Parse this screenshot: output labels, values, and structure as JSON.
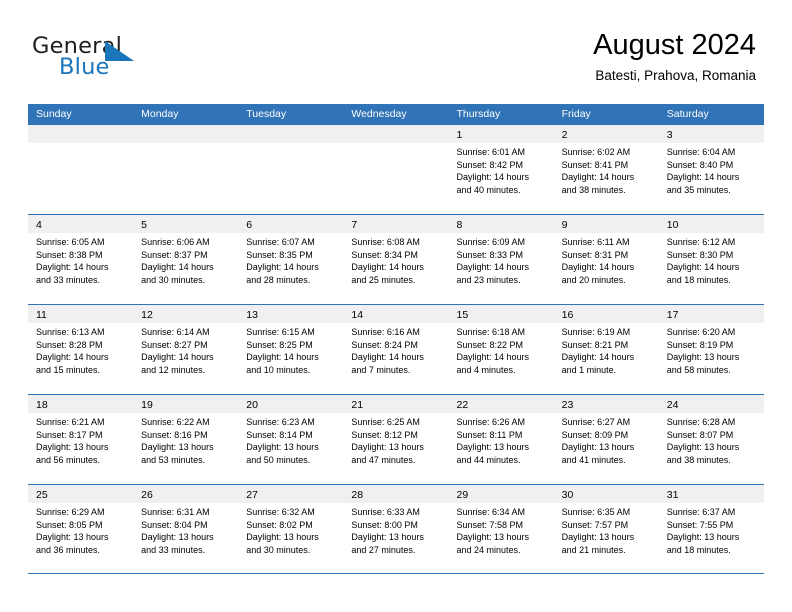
{
  "brand": {
    "name_top": "General",
    "name_bottom": "Blue",
    "accent_color": "#1b75bb"
  },
  "header": {
    "title": "August 2024",
    "subtitle": "Batesti, Prahova, Romania"
  },
  "theme": {
    "header_band_color": "#3073b6",
    "day_band_color": "#f0f0f0",
    "text_color": "#000000"
  },
  "calendar": {
    "weekday_headers": [
      "Sunday",
      "Monday",
      "Tuesday",
      "Wednesday",
      "Thursday",
      "Friday",
      "Saturday"
    ],
    "weeks": [
      [
        {
          "day": "",
          "sunrise": "",
          "sunset": "",
          "daylight": "",
          "daylight_cont": ""
        },
        {
          "day": "",
          "sunrise": "",
          "sunset": "",
          "daylight": "",
          "daylight_cont": ""
        },
        {
          "day": "",
          "sunrise": "",
          "sunset": "",
          "daylight": "",
          "daylight_cont": ""
        },
        {
          "day": "",
          "sunrise": "",
          "sunset": "",
          "daylight": "",
          "daylight_cont": ""
        },
        {
          "day": "1",
          "sunrise": "Sunrise: 6:01 AM",
          "sunset": "Sunset: 8:42 PM",
          "daylight": "Daylight: 14 hours",
          "daylight_cont": "and 40 minutes."
        },
        {
          "day": "2",
          "sunrise": "Sunrise: 6:02 AM",
          "sunset": "Sunset: 8:41 PM",
          "daylight": "Daylight: 14 hours",
          "daylight_cont": "and 38 minutes."
        },
        {
          "day": "3",
          "sunrise": "Sunrise: 6:04 AM",
          "sunset": "Sunset: 8:40 PM",
          "daylight": "Daylight: 14 hours",
          "daylight_cont": "and 35 minutes."
        }
      ],
      [
        {
          "day": "4",
          "sunrise": "Sunrise: 6:05 AM",
          "sunset": "Sunset: 8:38 PM",
          "daylight": "Daylight: 14 hours",
          "daylight_cont": "and 33 minutes."
        },
        {
          "day": "5",
          "sunrise": "Sunrise: 6:06 AM",
          "sunset": "Sunset: 8:37 PM",
          "daylight": "Daylight: 14 hours",
          "daylight_cont": "and 30 minutes."
        },
        {
          "day": "6",
          "sunrise": "Sunrise: 6:07 AM",
          "sunset": "Sunset: 8:35 PM",
          "daylight": "Daylight: 14 hours",
          "daylight_cont": "and 28 minutes."
        },
        {
          "day": "7",
          "sunrise": "Sunrise: 6:08 AM",
          "sunset": "Sunset: 8:34 PM",
          "daylight": "Daylight: 14 hours",
          "daylight_cont": "and 25 minutes."
        },
        {
          "day": "8",
          "sunrise": "Sunrise: 6:09 AM",
          "sunset": "Sunset: 8:33 PM",
          "daylight": "Daylight: 14 hours",
          "daylight_cont": "and 23 minutes."
        },
        {
          "day": "9",
          "sunrise": "Sunrise: 6:11 AM",
          "sunset": "Sunset: 8:31 PM",
          "daylight": "Daylight: 14 hours",
          "daylight_cont": "and 20 minutes."
        },
        {
          "day": "10",
          "sunrise": "Sunrise: 6:12 AM",
          "sunset": "Sunset: 8:30 PM",
          "daylight": "Daylight: 14 hours",
          "daylight_cont": "and 18 minutes."
        }
      ],
      [
        {
          "day": "11",
          "sunrise": "Sunrise: 6:13 AM",
          "sunset": "Sunset: 8:28 PM",
          "daylight": "Daylight: 14 hours",
          "daylight_cont": "and 15 minutes."
        },
        {
          "day": "12",
          "sunrise": "Sunrise: 6:14 AM",
          "sunset": "Sunset: 8:27 PM",
          "daylight": "Daylight: 14 hours",
          "daylight_cont": "and 12 minutes."
        },
        {
          "day": "13",
          "sunrise": "Sunrise: 6:15 AM",
          "sunset": "Sunset: 8:25 PM",
          "daylight": "Daylight: 14 hours",
          "daylight_cont": "and 10 minutes."
        },
        {
          "day": "14",
          "sunrise": "Sunrise: 6:16 AM",
          "sunset": "Sunset: 8:24 PM",
          "daylight": "Daylight: 14 hours",
          "daylight_cont": "and 7 minutes."
        },
        {
          "day": "15",
          "sunrise": "Sunrise: 6:18 AM",
          "sunset": "Sunset: 8:22 PM",
          "daylight": "Daylight: 14 hours",
          "daylight_cont": "and 4 minutes."
        },
        {
          "day": "16",
          "sunrise": "Sunrise: 6:19 AM",
          "sunset": "Sunset: 8:21 PM",
          "daylight": "Daylight: 14 hours",
          "daylight_cont": "and 1 minute."
        },
        {
          "day": "17",
          "sunrise": "Sunrise: 6:20 AM",
          "sunset": "Sunset: 8:19 PM",
          "daylight": "Daylight: 13 hours",
          "daylight_cont": "and 58 minutes."
        }
      ],
      [
        {
          "day": "18",
          "sunrise": "Sunrise: 6:21 AM",
          "sunset": "Sunset: 8:17 PM",
          "daylight": "Daylight: 13 hours",
          "daylight_cont": "and 56 minutes."
        },
        {
          "day": "19",
          "sunrise": "Sunrise: 6:22 AM",
          "sunset": "Sunset: 8:16 PM",
          "daylight": "Daylight: 13 hours",
          "daylight_cont": "and 53 minutes."
        },
        {
          "day": "20",
          "sunrise": "Sunrise: 6:23 AM",
          "sunset": "Sunset: 8:14 PM",
          "daylight": "Daylight: 13 hours",
          "daylight_cont": "and 50 minutes."
        },
        {
          "day": "21",
          "sunrise": "Sunrise: 6:25 AM",
          "sunset": "Sunset: 8:12 PM",
          "daylight": "Daylight: 13 hours",
          "daylight_cont": "and 47 minutes."
        },
        {
          "day": "22",
          "sunrise": "Sunrise: 6:26 AM",
          "sunset": "Sunset: 8:11 PM",
          "daylight": "Daylight: 13 hours",
          "daylight_cont": "and 44 minutes."
        },
        {
          "day": "23",
          "sunrise": "Sunrise: 6:27 AM",
          "sunset": "Sunset: 8:09 PM",
          "daylight": "Daylight: 13 hours",
          "daylight_cont": "and 41 minutes."
        },
        {
          "day": "24",
          "sunrise": "Sunrise: 6:28 AM",
          "sunset": "Sunset: 8:07 PM",
          "daylight": "Daylight: 13 hours",
          "daylight_cont": "and 38 minutes."
        }
      ],
      [
        {
          "day": "25",
          "sunrise": "Sunrise: 6:29 AM",
          "sunset": "Sunset: 8:05 PM",
          "daylight": "Daylight: 13 hours",
          "daylight_cont": "and 36 minutes."
        },
        {
          "day": "26",
          "sunrise": "Sunrise: 6:31 AM",
          "sunset": "Sunset: 8:04 PM",
          "daylight": "Daylight: 13 hours",
          "daylight_cont": "and 33 minutes."
        },
        {
          "day": "27",
          "sunrise": "Sunrise: 6:32 AM",
          "sunset": "Sunset: 8:02 PM",
          "daylight": "Daylight: 13 hours",
          "daylight_cont": "and 30 minutes."
        },
        {
          "day": "28",
          "sunrise": "Sunrise: 6:33 AM",
          "sunset": "Sunset: 8:00 PM",
          "daylight": "Daylight: 13 hours",
          "daylight_cont": "and 27 minutes."
        },
        {
          "day": "29",
          "sunrise": "Sunrise: 6:34 AM",
          "sunset": "Sunset: 7:58 PM",
          "daylight": "Daylight: 13 hours",
          "daylight_cont": "and 24 minutes."
        },
        {
          "day": "30",
          "sunrise": "Sunrise: 6:35 AM",
          "sunset": "Sunset: 7:57 PM",
          "daylight": "Daylight: 13 hours",
          "daylight_cont": "and 21 minutes."
        },
        {
          "day": "31",
          "sunrise": "Sunrise: 6:37 AM",
          "sunset": "Sunset: 7:55 PM",
          "daylight": "Daylight: 13 hours",
          "daylight_cont": "and 18 minutes."
        }
      ]
    ]
  }
}
